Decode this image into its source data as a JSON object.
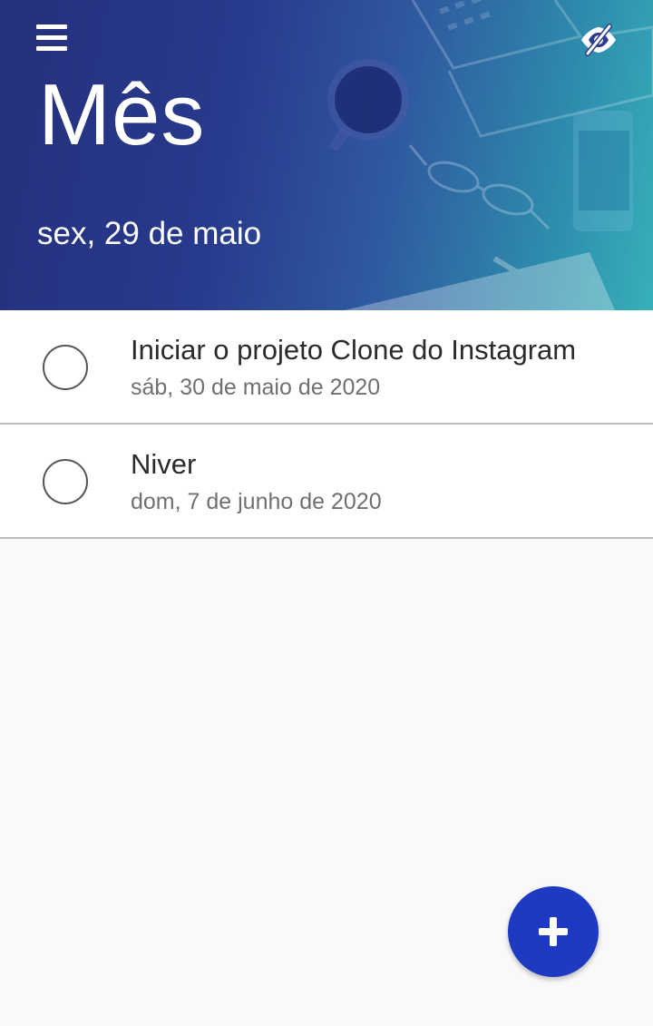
{
  "header": {
    "title": "Mês",
    "date": "sex, 29 de maio",
    "menu_icon": "hamburger-menu-icon",
    "visibility_icon": "eye-slash-icon",
    "gradient_colors": [
      "#25307d",
      "#283a8c",
      "#2f5aa0",
      "#2e8fae",
      "#37b0b8"
    ]
  },
  "tasks": [
    {
      "title": "Iniciar o projeto Clone do Instagram",
      "date": "sáb, 30 de maio de 2020",
      "done": false
    },
    {
      "title": "Niver",
      "date": "dom, 7 de junho de 2020",
      "done": false
    }
  ],
  "fab": {
    "icon": "plus-icon",
    "color": "#1f3ac2"
  }
}
